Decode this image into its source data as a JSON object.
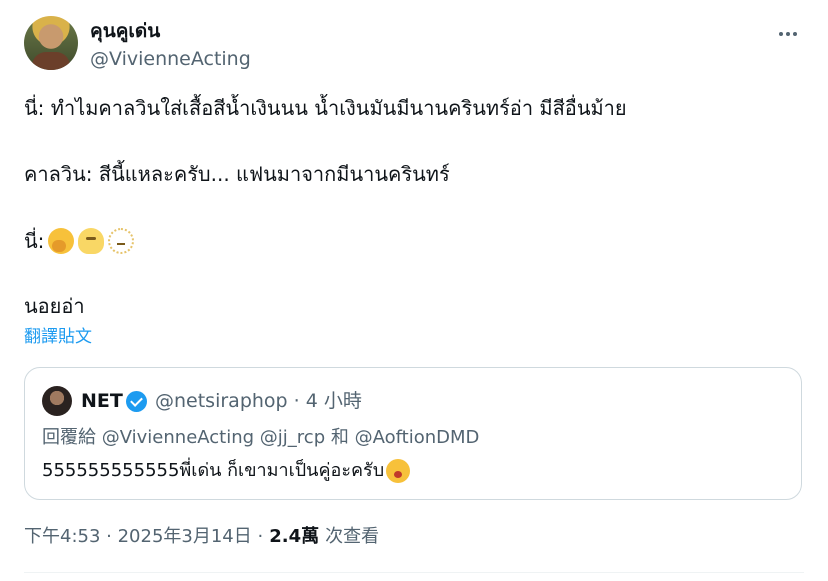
{
  "author": {
    "display_name": "คุนคูเด่น",
    "handle": "@VivienneActing"
  },
  "icons": {
    "avatar": "profile-photo",
    "more": "more-horizontal-icon",
    "verified": "verified-badge-icon",
    "emoji_line3": [
      "hand-over-mouth-emoji",
      "melting-face-emoji",
      "dotted-line-face-emoji"
    ],
    "emoji_quote": "flushed-face-emoji"
  },
  "tweet": {
    "line1": "นี่: ทำไมคาลวินใส่เสื้อสีน้ำเงินนน น้ำเงินมันมีนานครินทร์อ่า มีสีอื่นม้าย",
    "line2": "คาลวิน: สีนี้แหละครับ... แฟนมาจากมีนานครินทร์",
    "line3": "นี่:",
    "line4": "นอยอ่า",
    "translate_label": "翻譯貼文"
  },
  "quote": {
    "name": "NET",
    "meta": "@netsiraphop · 4 小時",
    "reply_prefix": "回覆給",
    "reply_to_1": "@VivienneActing",
    "reply_to_2": "@jj_rcp",
    "reply_and": "和",
    "reply_to_3": "@AoftionDMD",
    "text": "555555555555พี่เด่น ก็เขามาเป็นคู่อะครับ"
  },
  "footer": {
    "timestamp": "下午4:53 · 2025年3月14日 ·",
    "views_count": "2.4萬",
    "views_label": "次查看"
  },
  "colors": {
    "accent": "#1d9bf0",
    "text_primary": "#0f1419",
    "text_secondary": "#536471",
    "border": "#cfd9de"
  }
}
